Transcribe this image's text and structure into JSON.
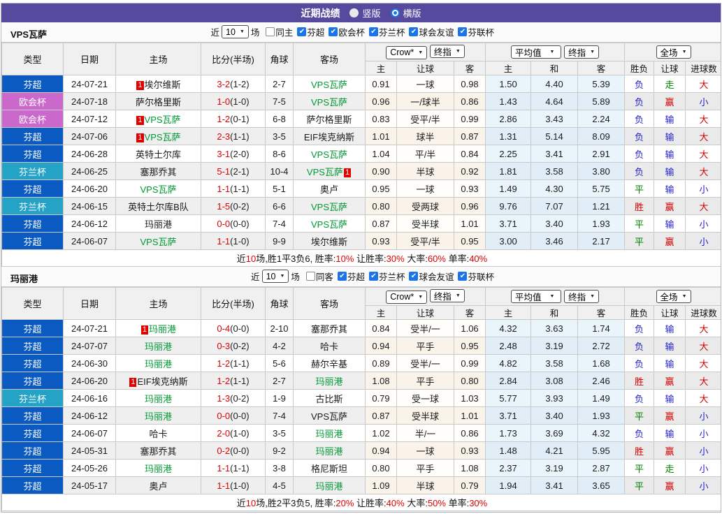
{
  "header": {
    "title": "近期战绩",
    "view_options": [
      {
        "label": "竖版",
        "selected": false
      },
      {
        "label": "横版",
        "selected": true
      }
    ]
  },
  "colors": {
    "titlebar": "#564a9e",
    "league": {
      "芬超": "#0a5ac2",
      "欧会杯": "#cb68cb",
      "芬兰杯": "#25a3c6"
    },
    "focus_team": "#009933",
    "score": "#e00000",
    "checkbox_accent": "#1b74e8",
    "result": {
      "胜": "#d40000",
      "平": "#008000",
      "负": "#2323cc",
      "赢": "#d40000",
      "走": "#008000",
      "输": "#2323cc",
      "大": "#d40000",
      "小": "#2323cc"
    }
  },
  "table_columns": {
    "main": [
      "类型",
      "日期",
      "主场",
      "比分(半场)",
      "角球",
      "客场"
    ],
    "sub": [
      "主",
      "让球",
      "客",
      "主",
      "和",
      "客",
      "胜负",
      "让球",
      "进球数"
    ],
    "group_selects": {
      "crow": [
        "Crow*",
        "终指"
      ],
      "average": [
        "平均值",
        "终指"
      ],
      "fulltime": [
        "全场"
      ]
    }
  },
  "tables": [
    {
      "team": "VPS瓦萨",
      "filter": {
        "near": "近",
        "count": "10",
        "games": "场",
        "venue": {
          "label": "同主",
          "checked": false
        },
        "leagues": [
          {
            "label": "芬超",
            "checked": true
          },
          {
            "label": "欧会杯",
            "checked": true
          },
          {
            "label": "芬兰杯",
            "checked": true
          },
          {
            "label": "球会友谊",
            "checked": true
          },
          {
            "label": "芬联杯",
            "checked": true
          }
        ]
      },
      "rows": [
        {
          "league": "芬超",
          "date": "24-07-21",
          "home": {
            "name": "埃尔维斯",
            "badge": "1"
          },
          "score": "3-2",
          "half": "(1-2)",
          "corner": "2-7",
          "away": {
            "name": "VPS瓦萨",
            "focus": true
          },
          "crow": [
            "0.91",
            "一球",
            "0.98"
          ],
          "avg": [
            "1.50",
            "4.40",
            "5.39"
          ],
          "results": [
            "负",
            "走",
            "大"
          ]
        },
        {
          "league": "欧会杯",
          "date": "24-07-18",
          "home": {
            "name": "萨尔格里斯"
          },
          "score": "1-0",
          "half": "(1-0)",
          "corner": "7-5",
          "away": {
            "name": "VPS瓦萨",
            "focus": true
          },
          "crow": [
            "0.96",
            "一/球半",
            "0.86"
          ],
          "avg": [
            "1.43",
            "4.64",
            "5.89"
          ],
          "results": [
            "负",
            "赢",
            "小"
          ]
        },
        {
          "league": "欧会杯",
          "date": "24-07-12",
          "home": {
            "name": "VPS瓦萨",
            "focus": true,
            "badge": "1"
          },
          "score": "1-2",
          "half": "(0-1)",
          "corner": "6-8",
          "away": {
            "name": "萨尔格里斯"
          },
          "crow": [
            "0.83",
            "受平/半",
            "0.99"
          ],
          "avg": [
            "2.86",
            "3.43",
            "2.24"
          ],
          "results": [
            "负",
            "输",
            "大"
          ]
        },
        {
          "league": "芬超",
          "date": "24-07-06",
          "home": {
            "name": "VPS瓦萨",
            "focus": true,
            "badge": "1"
          },
          "score": "2-3",
          "half": "(1-1)",
          "corner": "3-5",
          "away": {
            "name": "EIF埃克纳斯"
          },
          "crow": [
            "1.01",
            "球半",
            "0.87"
          ],
          "avg": [
            "1.31",
            "5.14",
            "8.09"
          ],
          "results": [
            "负",
            "输",
            "大"
          ]
        },
        {
          "league": "芬超",
          "date": "24-06-28",
          "home": {
            "name": "英特土尔库"
          },
          "score": "3-1",
          "half": "(2-0)",
          "corner": "8-6",
          "away": {
            "name": "VPS瓦萨",
            "focus": true
          },
          "crow": [
            "1.04",
            "平/半",
            "0.84"
          ],
          "avg": [
            "2.25",
            "3.41",
            "2.91"
          ],
          "results": [
            "负",
            "输",
            "大"
          ]
        },
        {
          "league": "芬兰杯",
          "date": "24-06-25",
          "home": {
            "name": "塞那乔其"
          },
          "score": "5-1",
          "half": "(2-1)",
          "corner": "10-4",
          "away": {
            "name": "VPS瓦萨",
            "focus": true,
            "badge": "1",
            "badge_pos": "post"
          },
          "crow": [
            "0.90",
            "半球",
            "0.92"
          ],
          "avg": [
            "1.81",
            "3.58",
            "3.80"
          ],
          "results": [
            "负",
            "输",
            "大"
          ]
        },
        {
          "league": "芬超",
          "date": "24-06-20",
          "home": {
            "name": "VPS瓦萨",
            "focus": true
          },
          "score": "1-1",
          "half": "(1-1)",
          "corner": "5-1",
          "away": {
            "name": "奥卢"
          },
          "crow": [
            "0.95",
            "一球",
            "0.93"
          ],
          "avg": [
            "1.49",
            "4.30",
            "5.75"
          ],
          "results": [
            "平",
            "输",
            "小"
          ]
        },
        {
          "league": "芬兰杯",
          "date": "24-06-15",
          "home": {
            "name": "英特土尔库B队"
          },
          "score": "1-5",
          "half": "(0-2)",
          "corner": "6-6",
          "away": {
            "name": "VPS瓦萨",
            "focus": true
          },
          "crow": [
            "0.80",
            "受两球",
            "0.96"
          ],
          "avg": [
            "9.76",
            "7.07",
            "1.21"
          ],
          "results": [
            "胜",
            "赢",
            "大"
          ]
        },
        {
          "league": "芬超",
          "date": "24-06-12",
          "home": {
            "name": "玛丽港"
          },
          "score": "0-0",
          "half": "(0-0)",
          "corner": "7-4",
          "away": {
            "name": "VPS瓦萨",
            "focus": true
          },
          "crow": [
            "0.87",
            "受半球",
            "1.01"
          ],
          "avg": [
            "3.71",
            "3.40",
            "1.93"
          ],
          "results": [
            "平",
            "输",
            "小"
          ]
        },
        {
          "league": "芬超",
          "date": "24-06-07",
          "home": {
            "name": "VPS瓦萨",
            "focus": true
          },
          "score": "1-1",
          "half": "(1-0)",
          "corner": "9-9",
          "away": {
            "name": "埃尔维斯"
          },
          "crow": [
            "0.93",
            "受平/半",
            "0.95"
          ],
          "avg": [
            "3.00",
            "3.46",
            "2.17"
          ],
          "results": [
            "平",
            "赢",
            "小"
          ]
        }
      ],
      "summary": [
        {
          "t": "近"
        },
        {
          "t": "10",
          "red": true
        },
        {
          "t": "场,胜1平3负6, 胜率:"
        },
        {
          "t": "10%",
          "red": true
        },
        {
          "t": " 让胜率:"
        },
        {
          "t": "30%",
          "red": true
        },
        {
          "t": " 大率:"
        },
        {
          "t": "60%",
          "red": true
        },
        {
          "t": " 单率:"
        },
        {
          "t": "40%",
          "red": true
        }
      ]
    },
    {
      "team": "玛丽港",
      "filter": {
        "near": "近",
        "count": "10",
        "games": "场",
        "venue": {
          "label": "同客",
          "checked": false
        },
        "leagues": [
          {
            "label": "芬超",
            "checked": true
          },
          {
            "label": "芬兰杯",
            "checked": true
          },
          {
            "label": "球会友谊",
            "checked": true
          },
          {
            "label": "芬联杯",
            "checked": true
          }
        ]
      },
      "rows": [
        {
          "league": "芬超",
          "date": "24-07-21",
          "home": {
            "name": "玛丽港",
            "focus": true,
            "badge": "1"
          },
          "score": "0-4",
          "half": "(0-0)",
          "corner": "2-10",
          "away": {
            "name": "塞那乔其"
          },
          "crow": [
            "0.84",
            "受半/一",
            "1.06"
          ],
          "avg": [
            "4.32",
            "3.63",
            "1.74"
          ],
          "results": [
            "负",
            "输",
            "大"
          ]
        },
        {
          "league": "芬超",
          "date": "24-07-07",
          "home": {
            "name": "玛丽港",
            "focus": true
          },
          "score": "0-3",
          "half": "(0-2)",
          "corner": "4-2",
          "away": {
            "name": "哈卡"
          },
          "crow": [
            "0.94",
            "平手",
            "0.95"
          ],
          "avg": [
            "2.48",
            "3.19",
            "2.72"
          ],
          "results": [
            "负",
            "输",
            "大"
          ]
        },
        {
          "league": "芬超",
          "date": "24-06-30",
          "home": {
            "name": "玛丽港",
            "focus": true
          },
          "score": "1-2",
          "half": "(1-1)",
          "corner": "5-6",
          "away": {
            "name": "赫尔辛基"
          },
          "crow": [
            "0.89",
            "受半/一",
            "0.99"
          ],
          "avg": [
            "4.82",
            "3.58",
            "1.68"
          ],
          "results": [
            "负",
            "输",
            "大"
          ]
        },
        {
          "league": "芬超",
          "date": "24-06-20",
          "home": {
            "name": "EIF埃克纳斯",
            "badge": "1"
          },
          "score": "1-2",
          "half": "(1-1)",
          "corner": "2-7",
          "away": {
            "name": "玛丽港",
            "focus": true
          },
          "crow": [
            "1.08",
            "平手",
            "0.80"
          ],
          "avg": [
            "2.84",
            "3.08",
            "2.46"
          ],
          "results": [
            "胜",
            "赢",
            "大"
          ]
        },
        {
          "league": "芬兰杯",
          "date": "24-06-16",
          "home": {
            "name": "玛丽港",
            "focus": true
          },
          "score": "1-3",
          "half": "(0-2)",
          "corner": "1-9",
          "away": {
            "name": "古比斯"
          },
          "crow": [
            "0.79",
            "受一球",
            "1.03"
          ],
          "avg": [
            "5.77",
            "3.93",
            "1.49"
          ],
          "results": [
            "负",
            "输",
            "大"
          ]
        },
        {
          "league": "芬超",
          "date": "24-06-12",
          "home": {
            "name": "玛丽港",
            "focus": true
          },
          "score": "0-0",
          "half": "(0-0)",
          "corner": "7-4",
          "away": {
            "name": "VPS瓦萨"
          },
          "crow": [
            "0.87",
            "受半球",
            "1.01"
          ],
          "avg": [
            "3.71",
            "3.40",
            "1.93"
          ],
          "results": [
            "平",
            "赢",
            "小"
          ]
        },
        {
          "league": "芬超",
          "date": "24-06-07",
          "home": {
            "name": "哈卡"
          },
          "score": "2-0",
          "half": "(1-0)",
          "corner": "3-5",
          "away": {
            "name": "玛丽港",
            "focus": true
          },
          "crow": [
            "1.02",
            "半/一",
            "0.86"
          ],
          "avg": [
            "1.73",
            "3.69",
            "4.32"
          ],
          "results": [
            "负",
            "输",
            "小"
          ]
        },
        {
          "league": "芬超",
          "date": "24-05-31",
          "home": {
            "name": "塞那乔其"
          },
          "score": "0-2",
          "half": "(0-0)",
          "corner": "9-2",
          "away": {
            "name": "玛丽港",
            "focus": true
          },
          "crow": [
            "0.94",
            "一球",
            "0.93"
          ],
          "avg": [
            "1.48",
            "4.21",
            "5.95"
          ],
          "results": [
            "胜",
            "赢",
            "小"
          ]
        },
        {
          "league": "芬超",
          "date": "24-05-26",
          "home": {
            "name": "玛丽港",
            "focus": true
          },
          "score": "1-1",
          "half": "(1-1)",
          "corner": "3-8",
          "away": {
            "name": "格尼斯坦"
          },
          "crow": [
            "0.80",
            "平手",
            "1.08"
          ],
          "avg": [
            "2.37",
            "3.19",
            "2.87"
          ],
          "results": [
            "平",
            "走",
            "小"
          ]
        },
        {
          "league": "芬超",
          "date": "24-05-17",
          "home": {
            "name": "奥卢"
          },
          "score": "1-1",
          "half": "(1-0)",
          "corner": "4-5",
          "away": {
            "name": "玛丽港",
            "focus": true
          },
          "crow": [
            "1.09",
            "半球",
            "0.79"
          ],
          "avg": [
            "1.94",
            "3.41",
            "3.65"
          ],
          "results": [
            "平",
            "赢",
            "小"
          ]
        }
      ],
      "summary": [
        {
          "t": "近"
        },
        {
          "t": "10",
          "red": true
        },
        {
          "t": "场,胜2平3负5, 胜率:"
        },
        {
          "t": "20%",
          "red": true
        },
        {
          "t": " 让胜率:"
        },
        {
          "t": "40%",
          "red": true
        },
        {
          "t": " 大率:"
        },
        {
          "t": "50%",
          "red": true
        },
        {
          "t": " 单率:"
        },
        {
          "t": "30%",
          "red": true
        }
      ]
    }
  ]
}
